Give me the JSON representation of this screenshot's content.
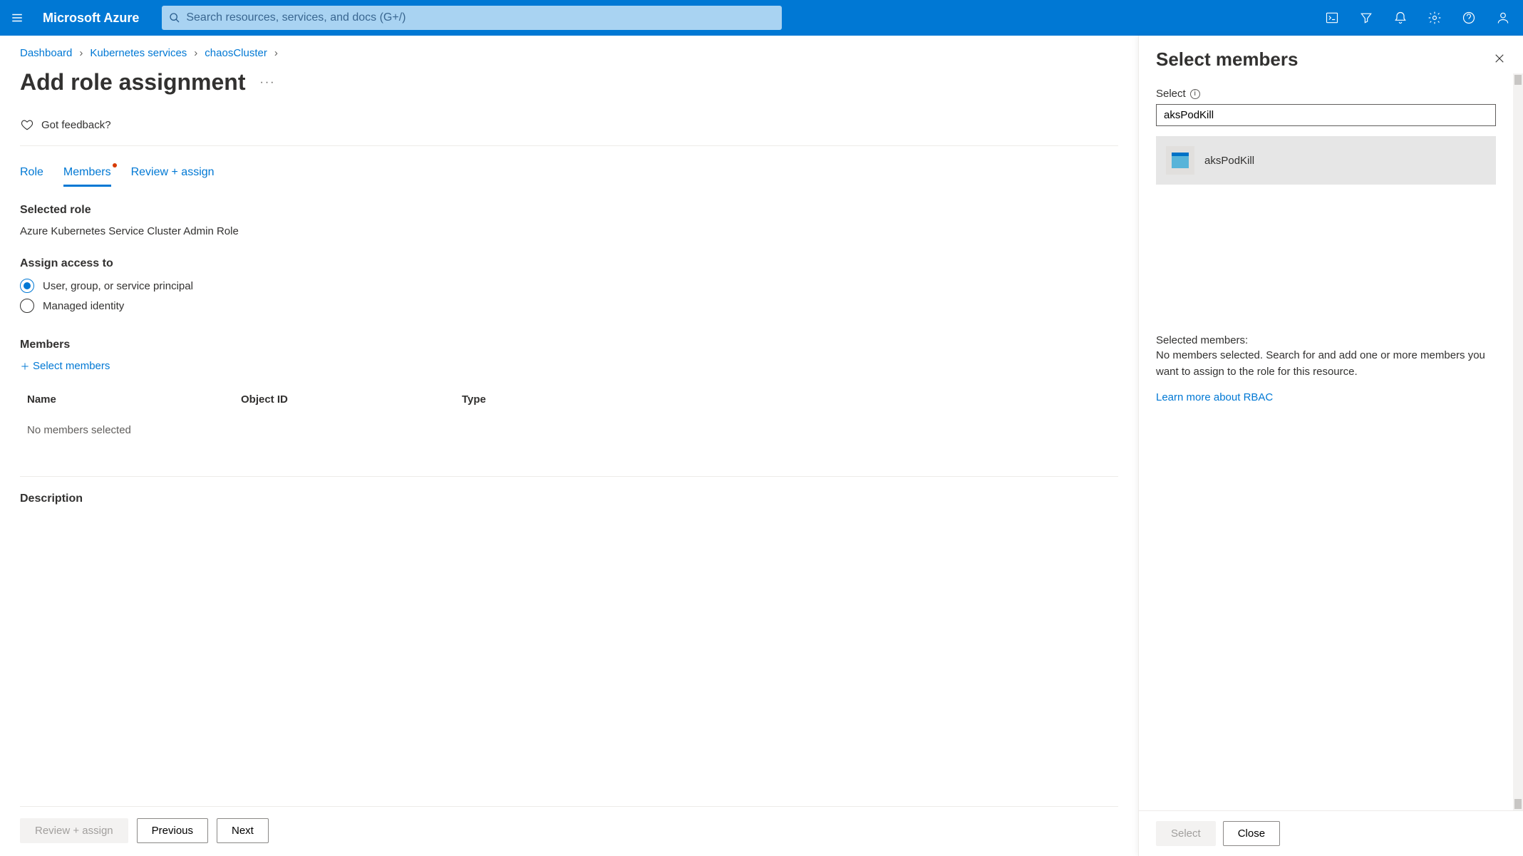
{
  "brand": "Microsoft Azure",
  "search": {
    "placeholder": "Search resources, services, and docs (G+/)"
  },
  "breadcrumb": [
    "Dashboard",
    "Kubernetes services",
    "chaosCluster"
  ],
  "page_title": "Add role assignment",
  "feedback": "Got feedback?",
  "tabs": {
    "role": "Role",
    "members": "Members",
    "review": "Review + assign"
  },
  "selected_role": {
    "label": "Selected role",
    "value": "Azure Kubernetes Service Cluster Admin Role"
  },
  "assign_access": {
    "label": "Assign access to",
    "opt1": "User, group, or service principal",
    "opt2": "Managed identity"
  },
  "members": {
    "label": "Members",
    "select_link": "Select members",
    "cols": {
      "name": "Name",
      "obj": "Object ID",
      "type": "Type"
    },
    "empty": "No members selected"
  },
  "description": {
    "label": "Description"
  },
  "footer": {
    "review": "Review + assign",
    "prev": "Previous",
    "next": "Next"
  },
  "blade": {
    "title": "Select members",
    "select_label": "Select",
    "input_value": "aksPodKill",
    "result": "aksPodKill",
    "selected_label": "Selected members:",
    "selected_msg": "No members selected. Search for and add one or more members you want to assign to the role for this resource.",
    "learn": "Learn more about RBAC",
    "select_btn": "Select",
    "close_btn": "Close"
  }
}
